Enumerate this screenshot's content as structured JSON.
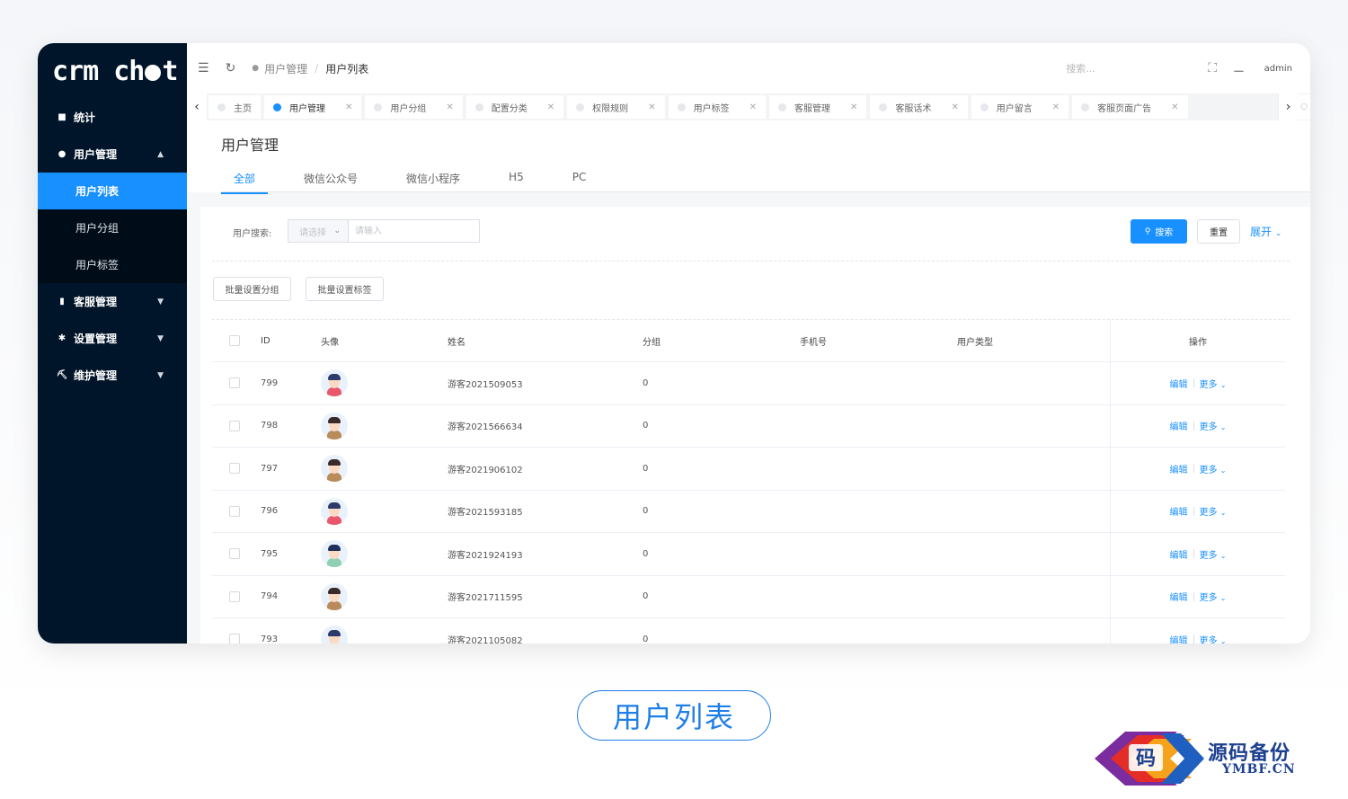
{
  "sidebar": {
    "logo": "crm chat",
    "items": [
      {
        "icon": "home-icon",
        "label": "统计"
      },
      {
        "icon": "user-icon",
        "label": "用户管理",
        "expanded": true,
        "children": [
          "用户列表",
          "用户分组",
          "用户标签"
        ],
        "active_child": "用户列表"
      },
      {
        "icon": "chat-icon",
        "label": "客服管理"
      },
      {
        "icon": "settings-icon",
        "label": "设置管理"
      },
      {
        "icon": "tool-icon",
        "label": "维护管理"
      }
    ]
  },
  "topbar": {
    "breadcrumb": [
      "用户管理",
      "用户列表"
    ],
    "search_placeholder": "搜索...",
    "user": "admin"
  },
  "tabs": [
    "主页",
    "用户管理",
    "用户分组",
    "配置分类",
    "权限规则",
    "用户标签",
    "客服管理",
    "客服话术",
    "用户留言",
    "客服页面广告"
  ],
  "active_tab": "用户管理",
  "page": {
    "title": "用户管理",
    "subtabs": [
      "全部",
      "微信公众号",
      "微信小程序",
      "H5",
      "PC"
    ],
    "active_subtab": "全部"
  },
  "filter": {
    "label": "用户搜索:",
    "select_placeholder": "请选择",
    "input_placeholder": "请输入",
    "search_button": "搜索",
    "reset_button": "重置",
    "expand_button": "展开"
  },
  "batch": {
    "set_group": "批量设置分组",
    "set_tag": "批量设置标签"
  },
  "table": {
    "headers": [
      "ID",
      "头像",
      "姓名",
      "分组",
      "手机号",
      "用户类型",
      "操作"
    ],
    "rows": [
      {
        "id": "799",
        "name": "游客2021509053",
        "group": "0",
        "phone": "",
        "type": "",
        "avatar": "girl"
      },
      {
        "id": "798",
        "name": "游客2021566634",
        "group": "0",
        "phone": "",
        "type": "",
        "avatar": "boy"
      },
      {
        "id": "797",
        "name": "游客2021906102",
        "group": "0",
        "phone": "",
        "type": "",
        "avatar": "boy"
      },
      {
        "id": "796",
        "name": "游客2021593185",
        "group": "0",
        "phone": "",
        "type": "",
        "avatar": "girl"
      },
      {
        "id": "795",
        "name": "游客2021924193",
        "group": "0",
        "phone": "",
        "type": "",
        "avatar": "man"
      },
      {
        "id": "794",
        "name": "游客2021711595",
        "group": "0",
        "phone": "",
        "type": "",
        "avatar": "boy"
      },
      {
        "id": "793",
        "name": "游客2021105082",
        "group": "0",
        "phone": "",
        "type": "",
        "avatar": "girl"
      }
    ],
    "edit_label": "编辑",
    "more_label": "更多"
  },
  "caption": "用户列表",
  "watermark": {
    "title": "源码备份",
    "site": "YMBF.CN",
    "glyph": "码"
  },
  "colors": {
    "primary": "#1890ff",
    "sidebar": "#001529",
    "caption": "#1f7fe8"
  }
}
